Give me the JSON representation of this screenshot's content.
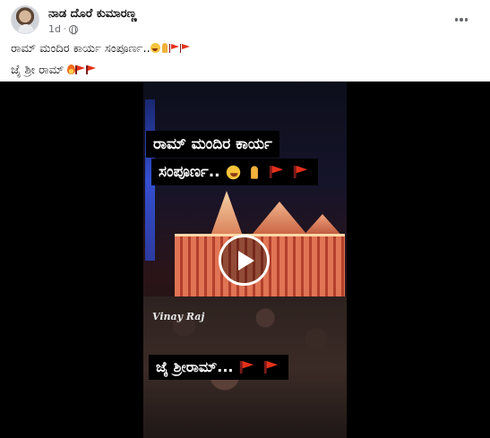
{
  "post": {
    "author": "ನಾಡ ದೊರೆ ಕುಮಾರಣ್ಣ",
    "time": "1d",
    "dot": "·",
    "caption_line1": "ರಾಮ್ ಮಂದಿರ ಕಾರ್ಯ ಸಂಪೂರ್ಣ..",
    "caption_line2": "ಜೈ ಶ್ರೀ ರಾಮ್",
    "more_icon": "more-options-icon"
  },
  "video": {
    "overlay_line1": "ರಾಮ್ ಮಂದಿರ ಕಾರ್ಯ",
    "overlay_line2": "ಸಂಪೂರ್ಣ..",
    "overlay_bottom": "ಜೈ ಶ್ರೀರಾಮ್...",
    "watermark": "Vinay Raj",
    "play_icon": "play-icon"
  },
  "colors": {
    "text_primary": "#050505",
    "text_secondary": "#65676b",
    "video_background": "#000000",
    "flag_red": "#e5301a"
  }
}
